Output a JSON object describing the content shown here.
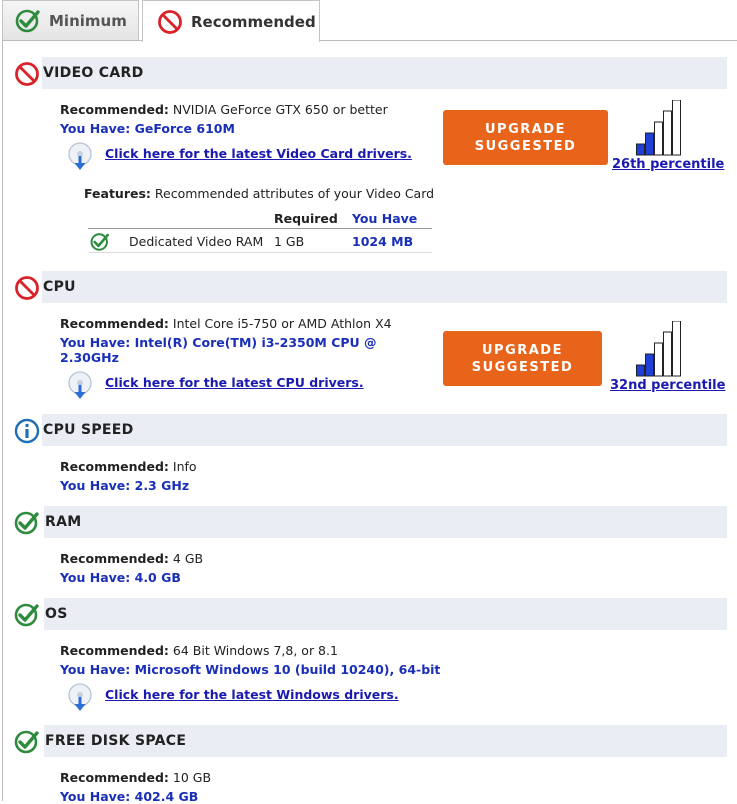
{
  "tabs": [
    {
      "label": "Minimum",
      "state": "pass"
    },
    {
      "label": "Recommended",
      "state": "fail",
      "active": true
    }
  ],
  "colors": {
    "pass": "#2e8b3d",
    "fail": "#d9222a",
    "info": "#1f6fb5",
    "upgrade": "#e8641a",
    "have": "#1a2fb8",
    "link": "#1a1ab0"
  },
  "labels": {
    "recommended_prefix": "Recommended:",
    "you_have_prefix": "You Have:",
    "features_prefix": "Features:",
    "upgrade_line1": "UPGRADE",
    "upgrade_line2": "SUGGESTED"
  },
  "sections": {
    "video": {
      "title": "VIDEO CARD",
      "status": "fail",
      "recommended": "NVIDIA GeForce GTX 650 or better",
      "you_have": "You Have: GeForce 610M",
      "driver_link": "Click here for the latest Video Card drivers.",
      "percentile": "26th percentile",
      "percentile_value": 26,
      "features_text": "Recommended attributes of your Video Card",
      "features_table": {
        "headers": [
          "Required",
          "You Have"
        ],
        "rows": [
          {
            "name": "Dedicated Video RAM",
            "required": "1 GB",
            "have": "1024 MB",
            "status": "pass"
          }
        ]
      }
    },
    "cpu": {
      "title": "CPU",
      "status": "fail",
      "recommended": "Intel Core i5-750 or AMD Athlon X4",
      "you_have_line1": "You Have: Intel(R) Core(TM) i3-2350M CPU @",
      "you_have_line2": "2.30GHz",
      "driver_link": "Click here for the latest CPU drivers.",
      "percentile": "32nd percentile",
      "percentile_value": 32
    },
    "cpu_speed": {
      "title": "CPU SPEED",
      "status": "info",
      "recommended": "Info",
      "you_have": "You Have: 2.3 GHz"
    },
    "ram": {
      "title": "RAM",
      "status": "pass",
      "recommended": "4 GB",
      "you_have": "You Have: 4.0 GB"
    },
    "os": {
      "title": "OS",
      "status": "pass",
      "recommended": "64 Bit Windows 7,8, or 8.1",
      "you_have": "You Have: Microsoft Windows 10 (build 10240), 64-bit",
      "driver_link": "Click here for the latest Windows drivers."
    },
    "disk": {
      "title": "FREE DISK SPACE",
      "status": "pass",
      "recommended": "10 GB",
      "you_have": "You Have: 402.4 GB"
    }
  }
}
